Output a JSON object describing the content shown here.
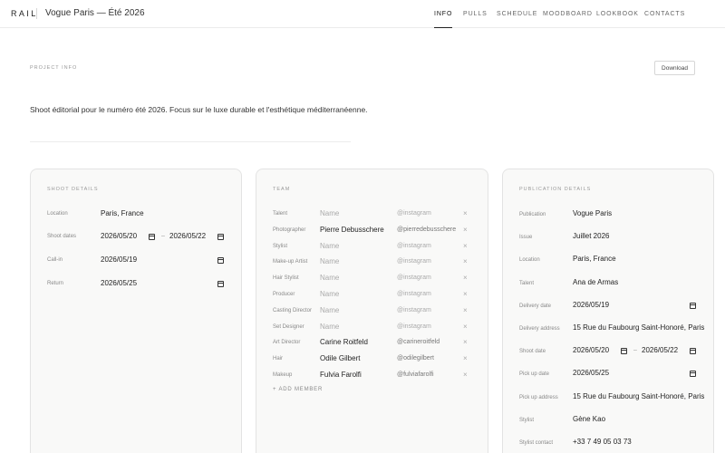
{
  "header": {
    "brand": "RAIL",
    "project_title": "Vogue Paris — Été 2026",
    "nav": [
      "INFO",
      "PULLS",
      "SCHEDULE",
      "MOODBOARD",
      "LOOKBOOK",
      "CONTACTS"
    ]
  },
  "project_info": {
    "label": "PROJECT INFO",
    "download": "Download",
    "description": "Shoot éditorial pour le numéro été 2026. Focus sur le luxe durable et l'esthétique méditerranéenne."
  },
  "shoot": {
    "title": "SHOOT DETAILS",
    "location_label": "Location",
    "location": "Paris, France",
    "dates_label": "Shoot dates",
    "date_start": "2026/05/20",
    "date_end": "2026/05/22",
    "date_separator": "–",
    "callin_label": "Call-in",
    "callin": "2026/05/19",
    "return_label": "Return",
    "return": "2026/05/25"
  },
  "team": {
    "title": "TEAM",
    "name_placeholder": "Name",
    "instagram_placeholder": "@instagram",
    "remove_glyph": "×",
    "add_member": "+ ADD MEMBER",
    "members": [
      {
        "role": "Talent",
        "name": "",
        "instagram": ""
      },
      {
        "role": "Photographer",
        "name": "Pierre Debusschere",
        "instagram": "@pierredebusschere"
      },
      {
        "role": "Stylist",
        "name": "",
        "instagram": ""
      },
      {
        "role": "Make-up Artist",
        "name": "",
        "instagram": ""
      },
      {
        "role": "Hair Stylist",
        "name": "",
        "instagram": ""
      },
      {
        "role": "Producer",
        "name": "",
        "instagram": ""
      },
      {
        "role": "Casting Director",
        "name": "",
        "instagram": ""
      },
      {
        "role": "Set Designer",
        "name": "",
        "instagram": ""
      },
      {
        "role": "Art Director",
        "name": "Carine Roitfeld",
        "instagram": "@carineroitfeld"
      },
      {
        "role": "Hair",
        "name": "Odile Gilbert",
        "instagram": "@odilegilbert"
      },
      {
        "role": "Makeup",
        "name": "Fulvia Farolfi",
        "instagram": "@fulviafarolfi"
      }
    ]
  },
  "publication": {
    "title": "PUBLICATION DETAILS",
    "date_separator": "–",
    "fields": [
      {
        "label": "Publication",
        "value": "Vogue Paris"
      },
      {
        "label": "Issue",
        "value": "Juillet 2026"
      },
      {
        "label": "Location",
        "value": "Paris, France"
      },
      {
        "label": "Talent",
        "value": "Ana de Armas"
      },
      {
        "label": "Delivery date",
        "value": "2026/05/19"
      },
      {
        "label": "Delivery address",
        "value": "15 Rue du Faubourg Saint-Honoré, Paris"
      },
      {
        "label": "Shoot date",
        "value": "2026/05/20",
        "end": "2026/05/22"
      },
      {
        "label": "Pick up date",
        "value": "2026/05/25"
      },
      {
        "label": "Pick up address",
        "value": "15 Rue du Faubourg Saint-Honoré, Paris"
      },
      {
        "label": "Stylist",
        "value": "Gène Kao"
      },
      {
        "label": "Stylist contact",
        "value": "+33 7 49 05 03 73"
      }
    ]
  }
}
